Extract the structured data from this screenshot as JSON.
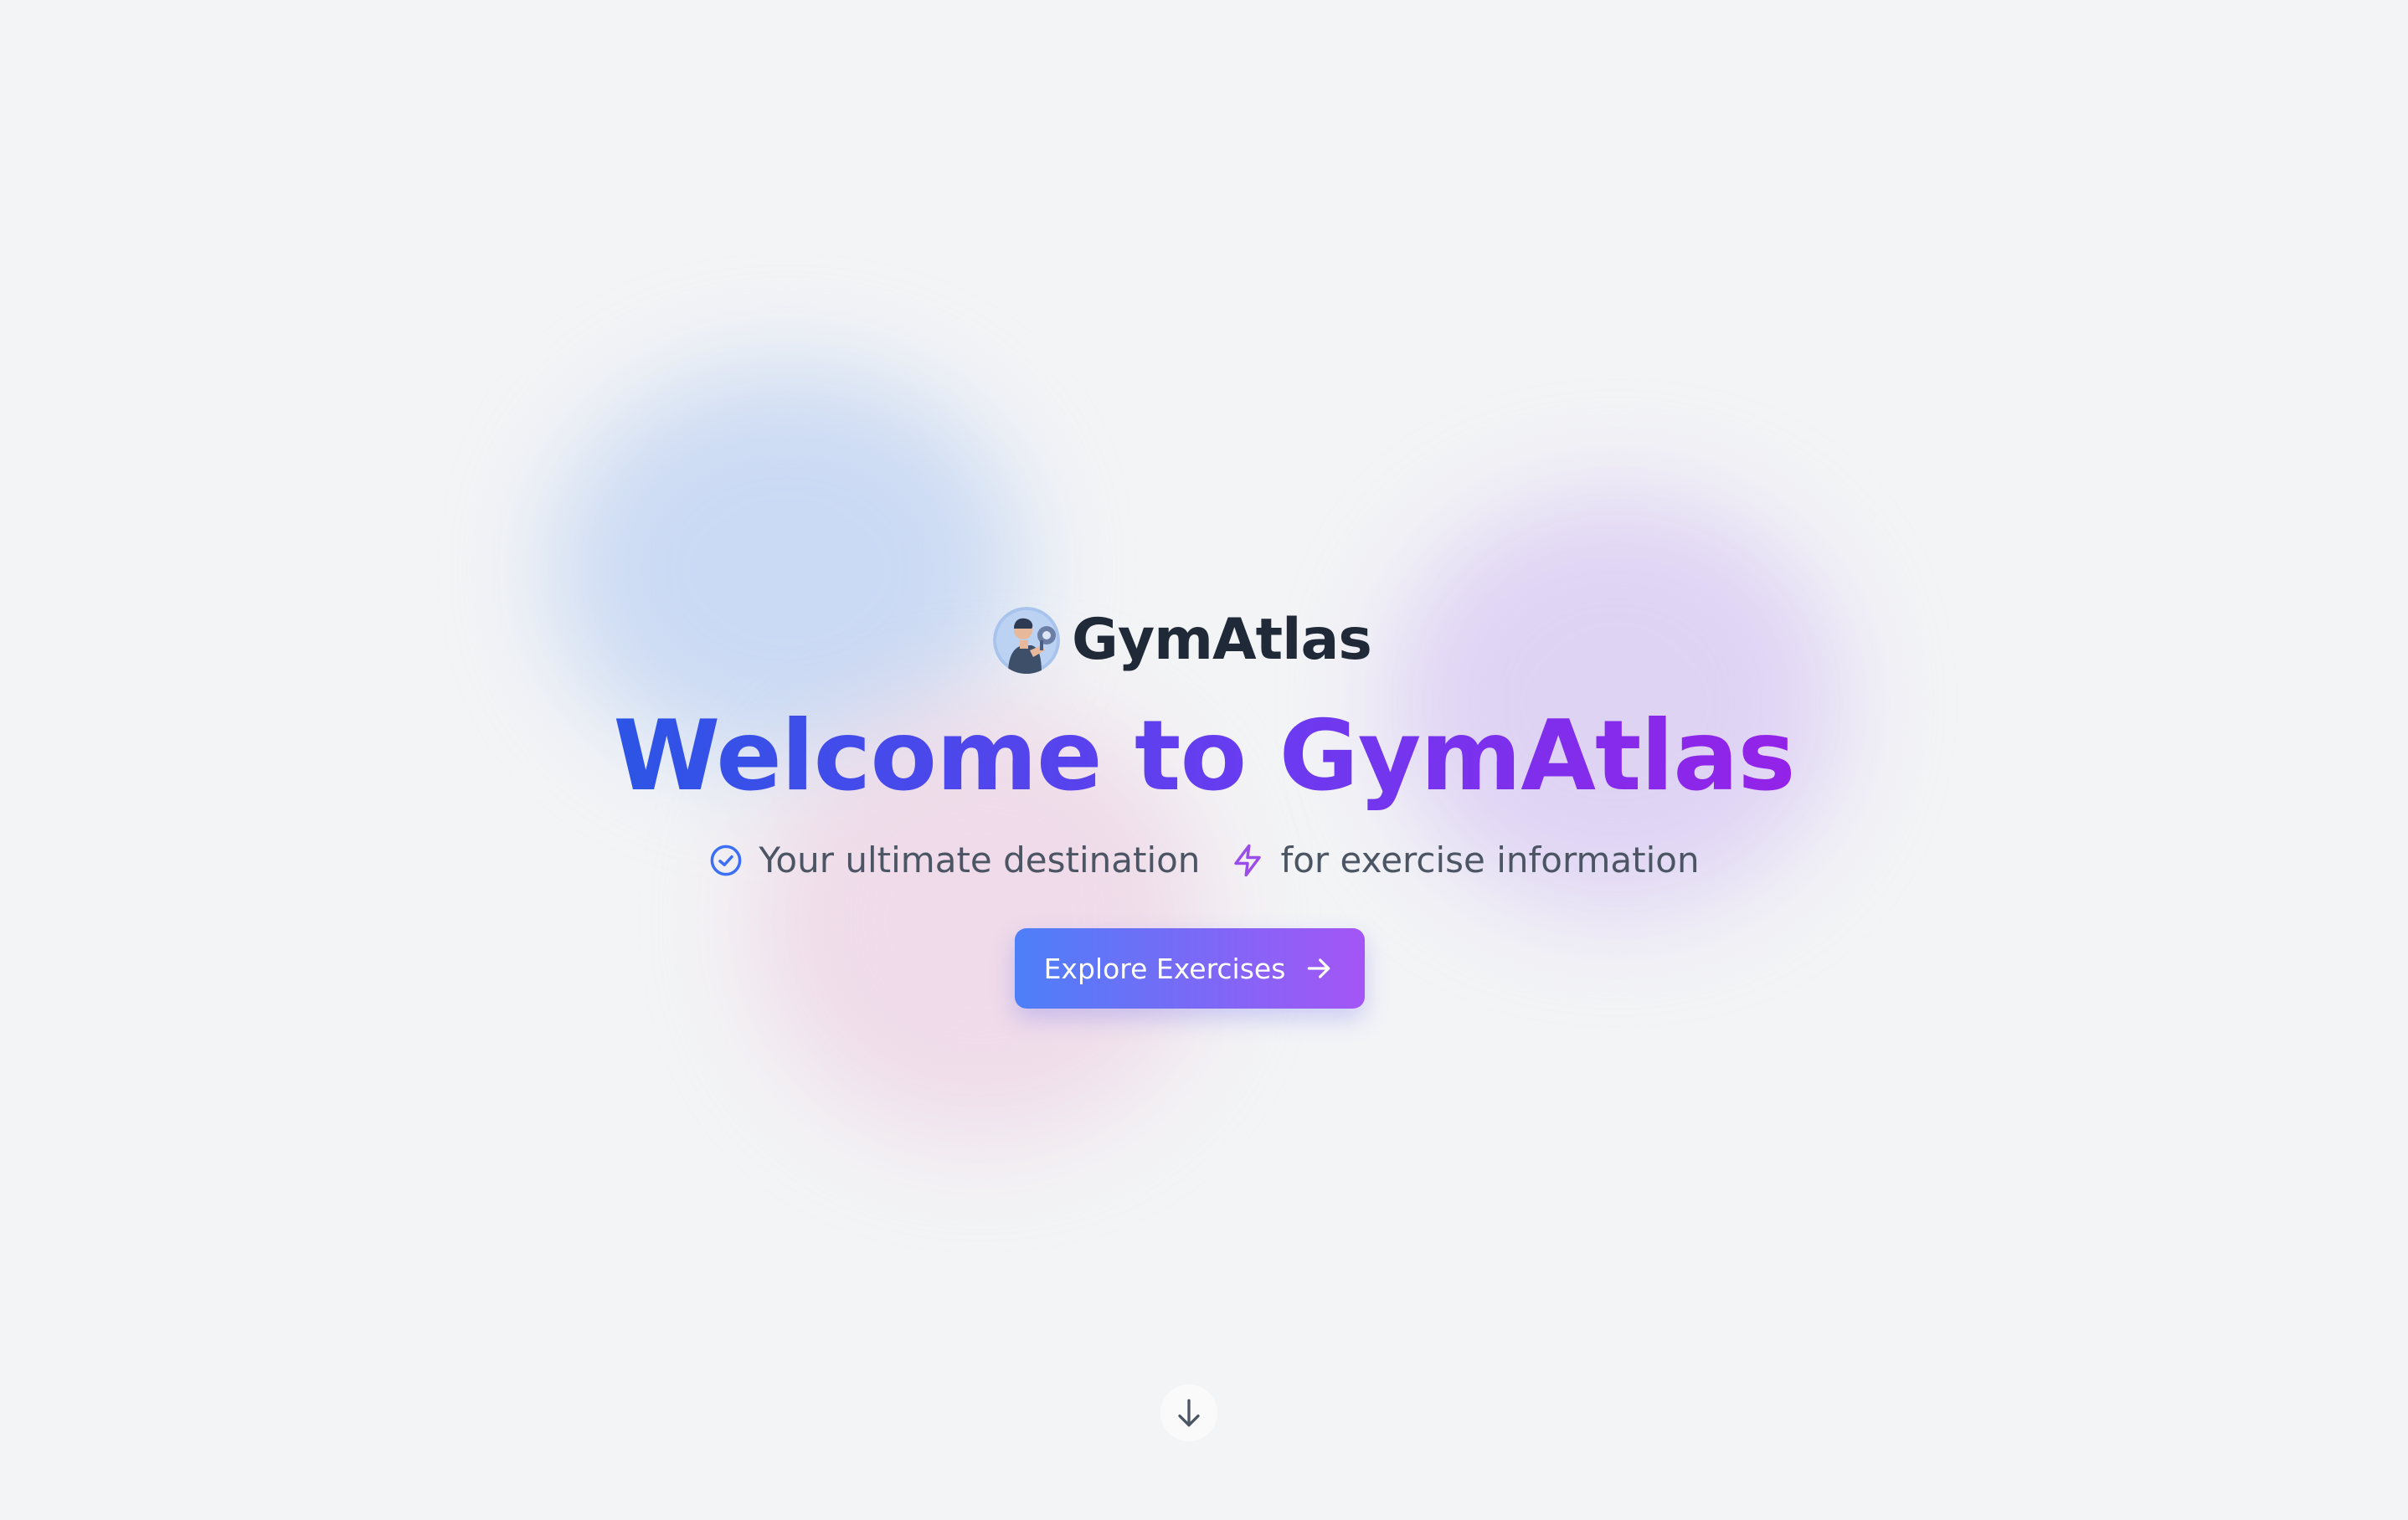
{
  "brand": {
    "name": "GymAtlas",
    "logo_icon": "gym-person-dumbbell-avatar"
  },
  "hero": {
    "headline": "Welcome to GymAtlas",
    "tagline": [
      {
        "icon": "check-circle-icon",
        "text": "Your ultimate destination",
        "color": "#3b6ff5"
      },
      {
        "icon": "lightning-bolt-icon",
        "text": "for exercise information",
        "color": "#9b4dea"
      }
    ],
    "cta_label": "Explore Exercises",
    "cta_icon": "arrow-right-icon",
    "scroll_icon": "arrow-down-icon"
  },
  "colors": {
    "background": "#f3f4f6",
    "headline_gradient": [
      "#2c55e6",
      "#9422e8"
    ],
    "button_gradient": [
      "#4d7ff8",
      "#a455f6"
    ],
    "brand_text": "#1f2937",
    "tagline_text": "#4b5563"
  }
}
